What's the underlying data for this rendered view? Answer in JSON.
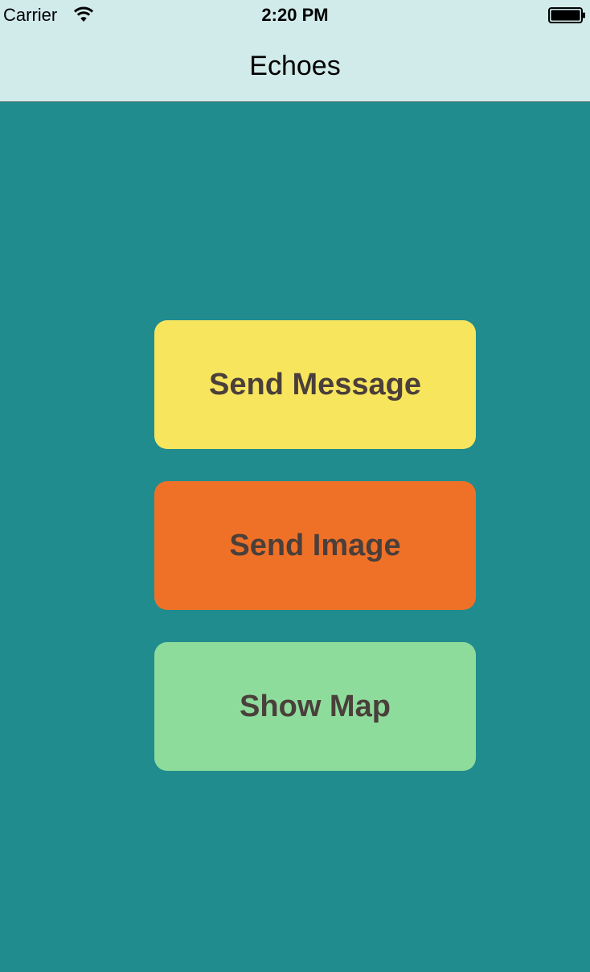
{
  "status_bar": {
    "carrier": "Carrier",
    "time": "2:20 PM",
    "wifi_icon": "wifi-icon",
    "battery_icon": "battery-full-icon"
  },
  "nav_bar": {
    "title": "Echoes"
  },
  "buttons": {
    "send_message": {
      "label": "Send Message",
      "color": "#f7e55e"
    },
    "send_image": {
      "label": "Send Image",
      "color": "#ef7128"
    },
    "show_map": {
      "label": "Show Map",
      "color": "#8edc9c"
    }
  },
  "colors": {
    "background": "#218c8d",
    "bar_background": "#d1eaea",
    "button_text": "#4a3f3a"
  }
}
